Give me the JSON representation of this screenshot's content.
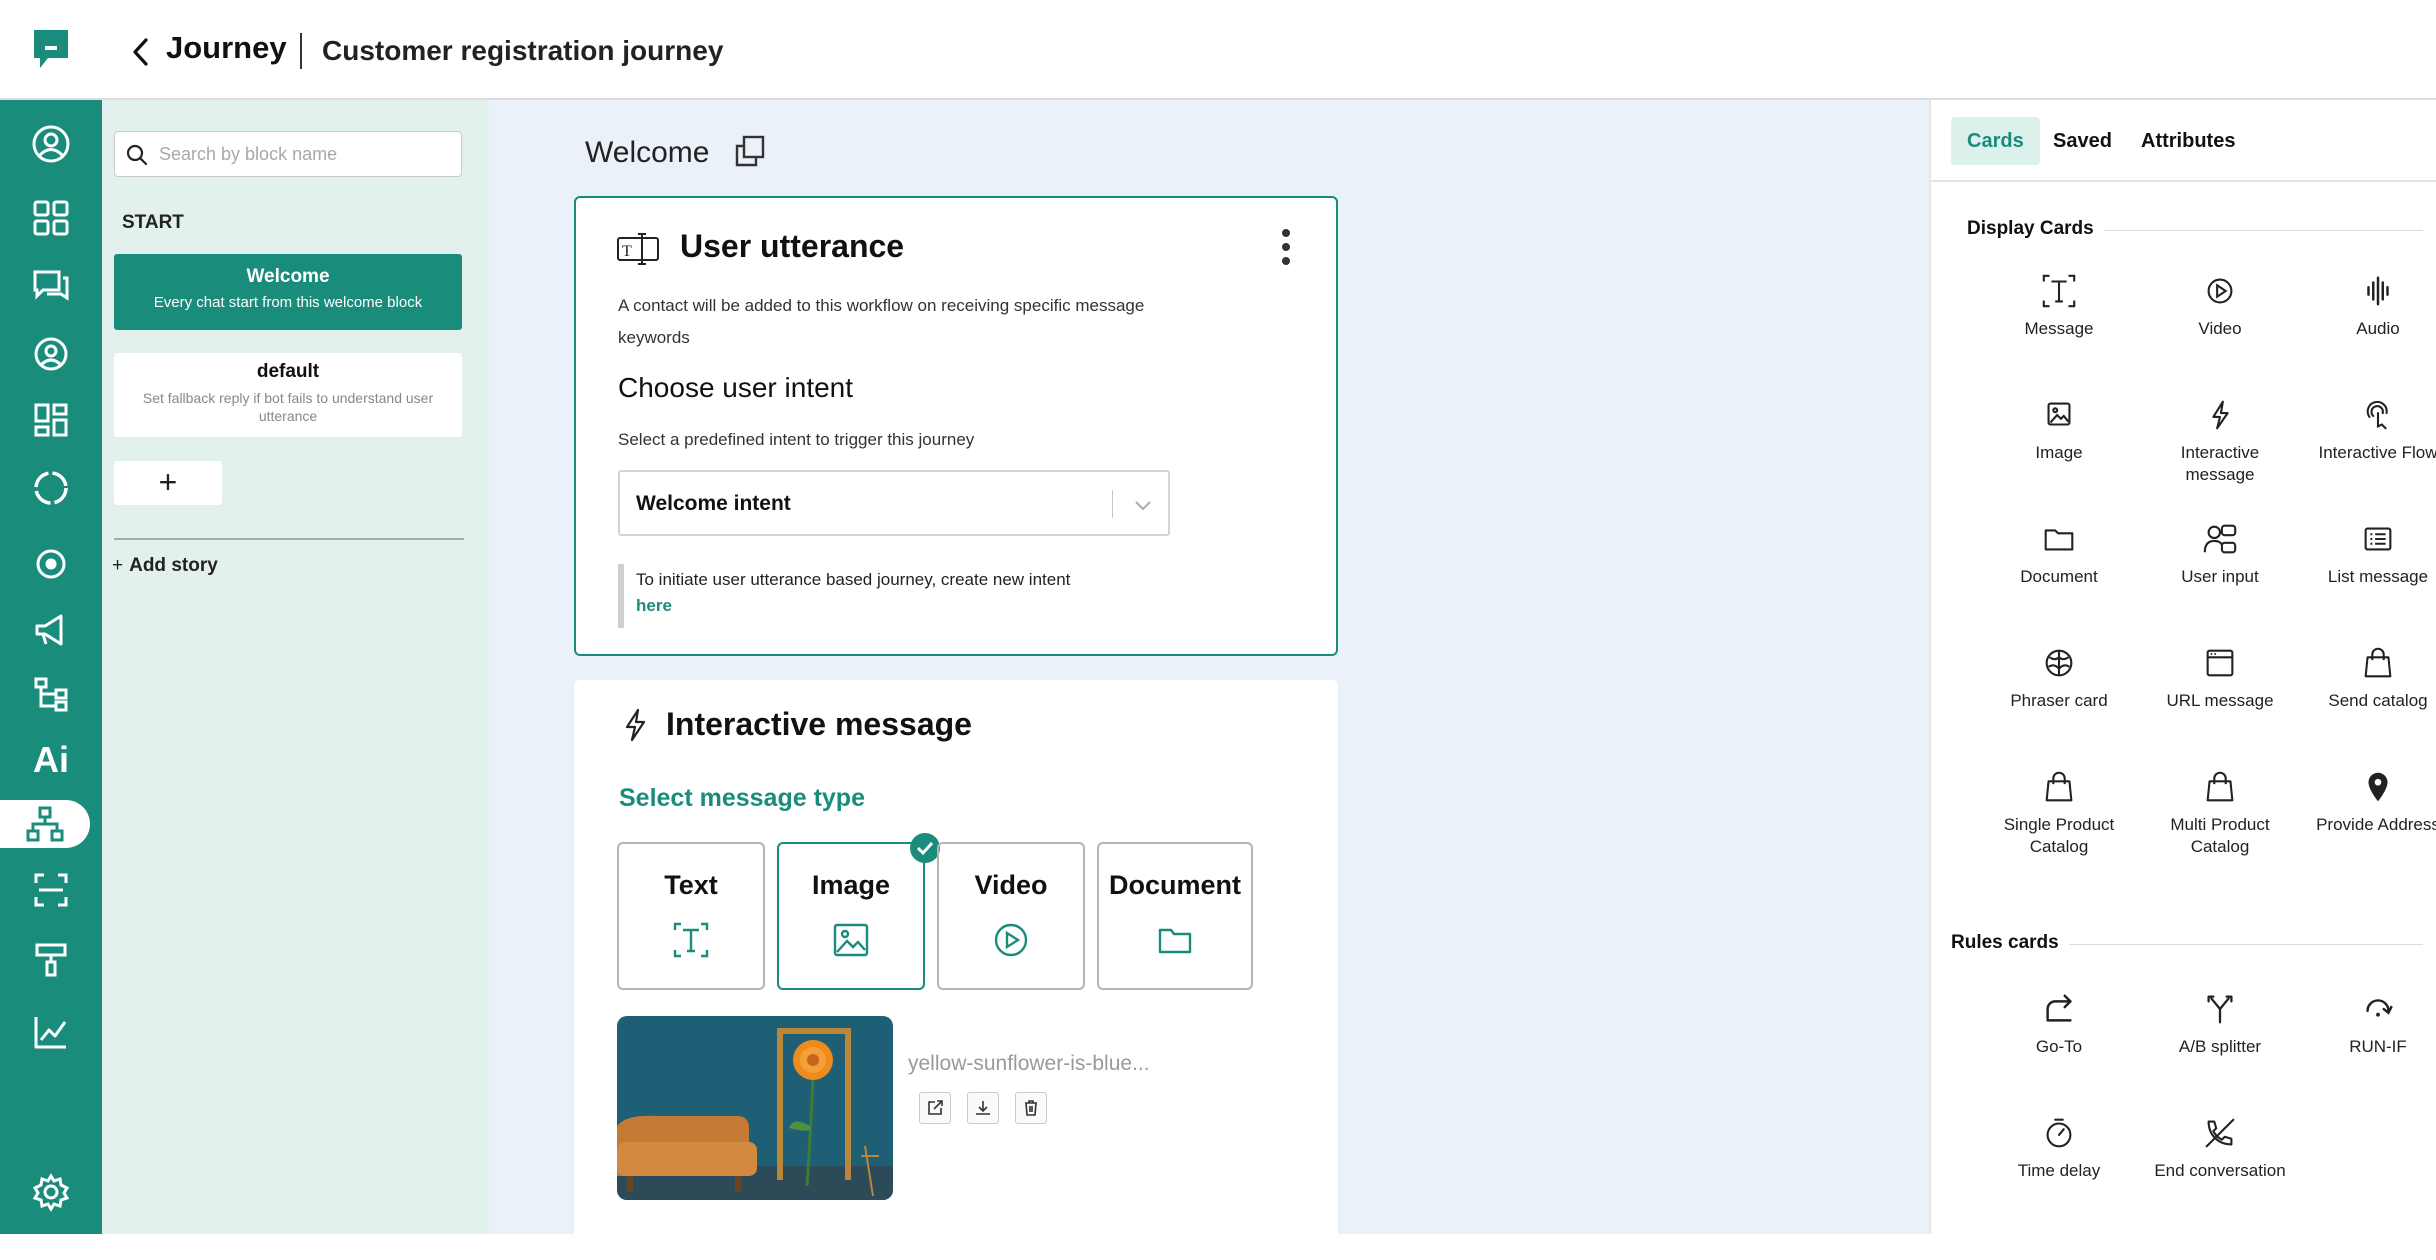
{
  "header": {
    "section": "Journey",
    "breadcrumb": "Customer registration journey"
  },
  "colors": {
    "brand": "#1a8c7c",
    "canvas": "#eaf1f9",
    "sidebar_bg": "#e3f1ee"
  },
  "nav_rail": [
    "contact-icon",
    "dashboard-icon",
    "chat-icon",
    "profile-icon",
    "widgets-icon",
    "lifebuoy-icon",
    "support-icon",
    "campaign-icon",
    "flow-icon",
    "ai-icon",
    "journey-icon",
    "scan-icon",
    "paint-icon",
    "analytics-icon",
    "settings-icon"
  ],
  "nav_rail_ai_label": "Ai",
  "blocks": {
    "search_placeholder": "Search by block name",
    "start_label": "START",
    "items": [
      {
        "name": "Welcome",
        "desc": "Every chat start from this welcome block"
      },
      {
        "name": "default",
        "desc": "Set fallback reply if bot fails to understand user utterance"
      }
    ],
    "add_block": "+",
    "add_story": "Add story",
    "add_story_plus": "+"
  },
  "canvas": {
    "title": "Welcome",
    "card1": {
      "title": "User utterance",
      "desc": "A contact will be added to this workflow on receiving specific message keywords",
      "heading": "Choose user intent",
      "sub": "Select a predefined intent to trigger this journey",
      "selected_intent": "Welcome intent",
      "note": "To initiate user utterance based journey, create new intent",
      "note_link": "here"
    },
    "card2": {
      "title": "Interactive message",
      "select_type": "Select message type",
      "types": [
        "Text",
        "Image",
        "Video",
        "Document"
      ],
      "selected_type": "Image",
      "image_name": "yellow-sunflower-is-blue..."
    }
  },
  "right_panel": {
    "tabs": [
      "Cards",
      "Saved",
      "Attributes"
    ],
    "active_tab": "Cards",
    "display_title": "Display Cards",
    "display_cards": [
      {
        "label": "Message",
        "icon": "text-icon"
      },
      {
        "label": "Video",
        "icon": "play-icon"
      },
      {
        "label": "Audio",
        "icon": "audio-icon"
      },
      {
        "label": "Image",
        "icon": "image-icon"
      },
      {
        "label": "Interactive message",
        "icon": "bolt-icon"
      },
      {
        "label": "Interactive Flow",
        "icon": "touch-icon"
      },
      {
        "label": "Document",
        "icon": "folder-icon"
      },
      {
        "label": "User input",
        "icon": "user-input-icon"
      },
      {
        "label": "List message",
        "icon": "list-icon"
      },
      {
        "label": "Phraser card",
        "icon": "brain-icon"
      },
      {
        "label": "URL message",
        "icon": "browser-icon"
      },
      {
        "label": "Send catalog",
        "icon": "bag-icon"
      },
      {
        "label": "Single Product Catalog",
        "icon": "bag-icon"
      },
      {
        "label": "Multi Product Catalog",
        "icon": "bag-icon"
      },
      {
        "label": "Provide Address",
        "icon": "pin-icon"
      }
    ],
    "rules_title": "Rules cards",
    "rules_cards": [
      {
        "label": "Go-To",
        "icon": "goto-icon"
      },
      {
        "label": "A/B splitter",
        "icon": "split-icon"
      },
      {
        "label": "RUN-IF",
        "icon": "runif-icon"
      },
      {
        "label": "Time delay",
        "icon": "timer-icon"
      },
      {
        "label": "End conversation",
        "icon": "end-call-icon"
      }
    ]
  }
}
